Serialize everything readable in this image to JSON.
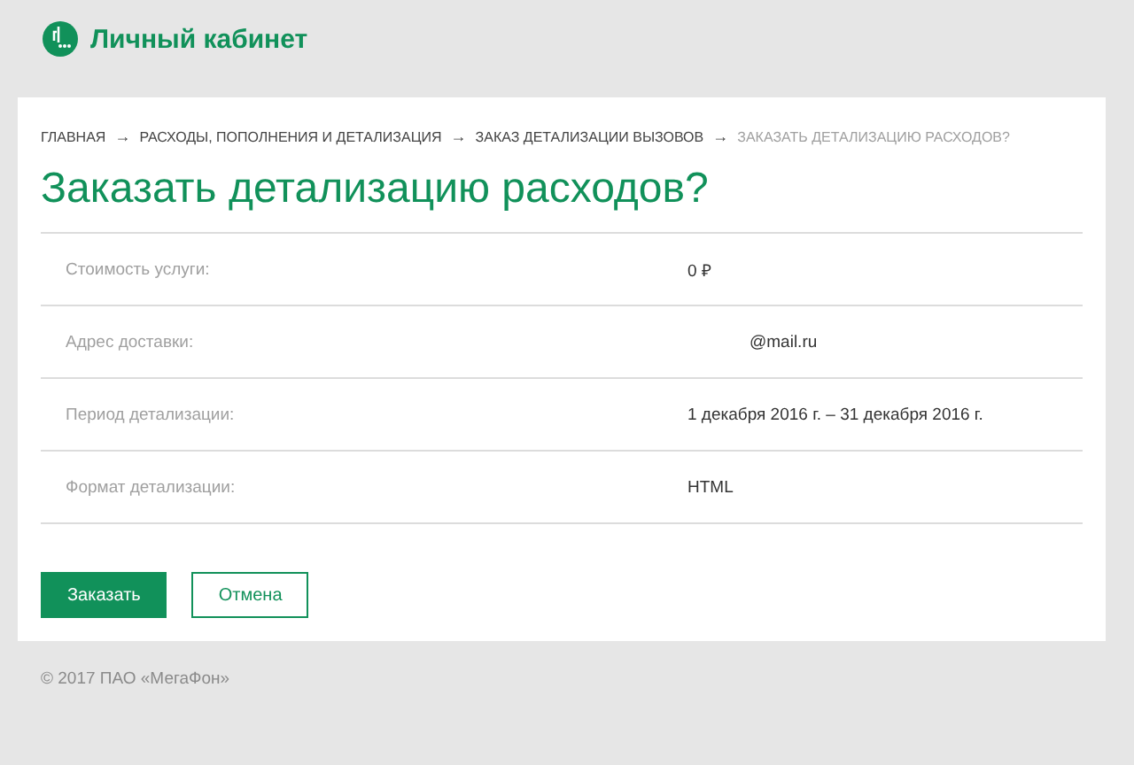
{
  "header": {
    "title": "Личный кабинет"
  },
  "breadcrumbs": [
    {
      "label": "ГЛАВНАЯ",
      "arrow": "→",
      "current": false
    },
    {
      "label": "РАСХОДЫ, ПОПОЛНЕНИЯ И ДЕТАЛИЗАЦИЯ",
      "arrow": "→",
      "current": false
    },
    {
      "label": "ЗАКАЗ ДЕТАЛИЗАЦИИ ВЫЗОВОВ",
      "arrow": "→",
      "current": false
    },
    {
      "label": "ЗАКАЗАТЬ ДЕТАЛИЗАЦИЮ РАСХОДОВ?",
      "current": true
    }
  ],
  "page_title": "Заказать детализацию расходов?",
  "details": [
    {
      "label": "Стоимость услуги:",
      "value": "0 ₽"
    },
    {
      "label": "Адрес доставки:",
      "value": "@mail.ru",
      "kind": "masked"
    },
    {
      "label": "Период детализации:",
      "value": "1 декабря 2016 г. – 31 декабря 2016 г."
    },
    {
      "label": "Формат детализации:",
      "value": "HTML"
    }
  ],
  "buttons": [
    {
      "label": "Заказать",
      "kind": "primary"
    },
    {
      "label": "Отмена",
      "kind": "secondary"
    }
  ],
  "footer": "© 2017 ПАО «МегаФон»"
}
